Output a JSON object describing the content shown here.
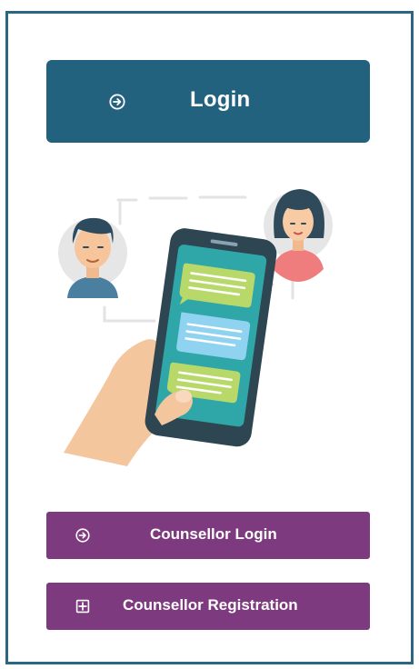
{
  "login": {
    "label": "Login",
    "icon": "arrow-circle-right-icon"
  },
  "illustration": {
    "icons": [
      "man-avatar-icon",
      "woman-avatar-icon",
      "smartphone-chat-icon",
      "hand-icon"
    ]
  },
  "counsellor_login": {
    "label": "Counsellor Login",
    "icon": "arrow-circle-right-icon"
  },
  "counsellor_registration": {
    "label": "Counsellor Registration",
    "icon": "plus-square-icon"
  },
  "colors": {
    "frame_border": "#2b6684",
    "login_bg": "#23627f",
    "purple_bg": "#7e3a7f",
    "text": "#ffffff"
  }
}
